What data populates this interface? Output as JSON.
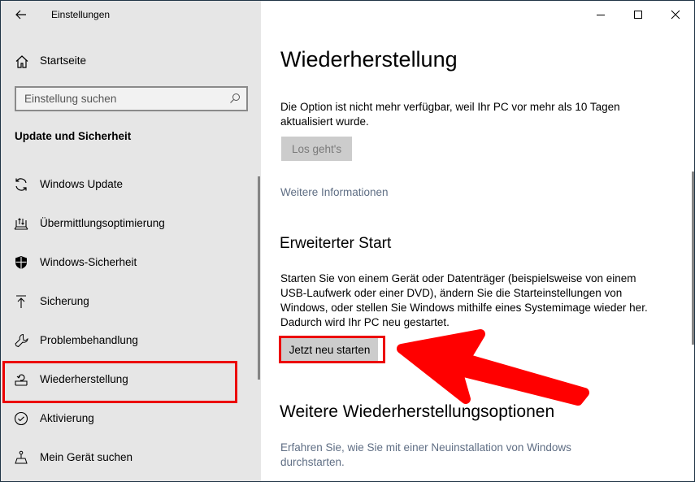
{
  "window": {
    "app_title": "Einstellungen",
    "controls": {
      "minimize_icon": "minimize-icon",
      "maximize_icon": "maximize-icon",
      "close_icon": "close-icon"
    }
  },
  "sidebar": {
    "back_icon": "back-arrow-icon",
    "home_label": "Startseite",
    "search": {
      "placeholder": "Einstellung suchen",
      "value": ""
    },
    "section_title": "Update und Sicherheit",
    "items": [
      {
        "label": "Windows Update",
        "icon": "sync-icon"
      },
      {
        "label": "Übermittlungsoptimierung",
        "icon": "delivery-optimization-icon"
      },
      {
        "label": "Windows-Sicherheit",
        "icon": "shield-icon"
      },
      {
        "label": "Sicherung",
        "icon": "backup-upload-icon"
      },
      {
        "label": "Problembehandlung",
        "icon": "wrench-icon"
      },
      {
        "label": "Wiederherstellung",
        "icon": "recovery-icon",
        "selected": true
      },
      {
        "label": "Aktivierung",
        "icon": "checkmark-circle-icon"
      },
      {
        "label": "Mein Gerät suchen",
        "icon": "find-device-icon"
      }
    ]
  },
  "main": {
    "title": "Wiederherstellung",
    "rollback": {
      "description": "Die Option ist nicht mehr verfügbar, weil Ihr PC vor mehr als 10 Tagen aktualisiert wurde.",
      "button_label": "Los geht's",
      "button_enabled": false,
      "link": "Weitere Informationen"
    },
    "advanced_start": {
      "heading": "Erweiterter Start",
      "description": "Starten Sie von einem Gerät oder Datenträger (beispielsweise von einem USB-Laufwerk oder einer DVD), ändern Sie die Starteinstellungen von Windows, oder stellen Sie Windows mithilfe eines Systemimage wieder her. Dadurch wird Ihr PC neu gestartet.",
      "button_label": "Jetzt neu starten"
    },
    "more_options": {
      "heading": "Weitere Wiederherstellungsoptionen",
      "link": "Erfahren Sie, wie Sie mit einer Neuinstallation von Windows durchstarten."
    }
  },
  "annotations": {
    "highlight_color": "#ec0000",
    "arrow_color": "#ff0000"
  }
}
